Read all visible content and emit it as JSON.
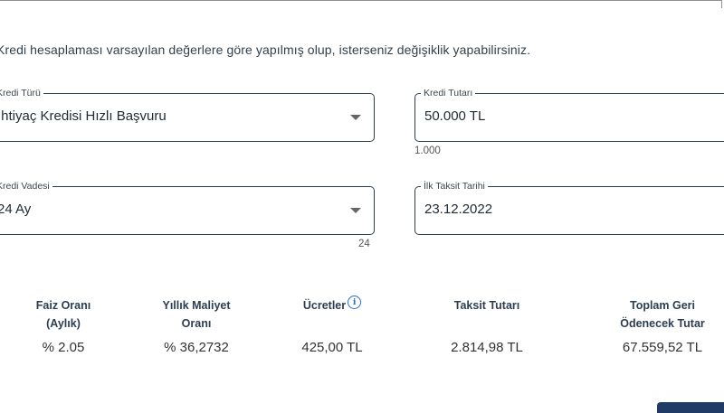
{
  "intro_text": "Kredi hesaplaması varsayılan değerlere göre yapılmış olup, isterseniz değişiklik yapabilirsiniz.",
  "form": {
    "credit_type": {
      "label": "Kredi Türü",
      "value": "İhtiyaç Kredisi Hızlı Başvuru"
    },
    "credit_amount": {
      "label": "Kredi Tutarı",
      "value": "50.000 TL",
      "helper": "1.000"
    },
    "credit_term": {
      "label": "Kredi Vadesi",
      "value": "24 Ay",
      "helper": "24"
    },
    "first_installment_date": {
      "label": "İlk Taksit Tarihi",
      "value": "23.12.2022"
    }
  },
  "summary": {
    "interest_rate": {
      "label_line1": "Faiz Oranı",
      "label_line2": "(Aylık)",
      "value": "% 2.05"
    },
    "annual_cost": {
      "label_line1": "Yıllık Maliyet",
      "label_line2": "Oranı",
      "value": "% 36,2732"
    },
    "fees": {
      "label": "Ücretler",
      "value": "425,00 TL",
      "icon": "info-icon"
    },
    "installment": {
      "label": "Taksit Tutarı",
      "value": "2.814,98 TL"
    },
    "total_repayment": {
      "label_line1": "Toplam Geri",
      "label_line2": "Ödenecek Tutar",
      "value": "67.559,52 TL"
    }
  },
  "colors": {
    "border": "#2f3d4c",
    "info_icon": "#2a6fc9",
    "header_text": "#2c3e52",
    "button": "#1f3b66"
  }
}
